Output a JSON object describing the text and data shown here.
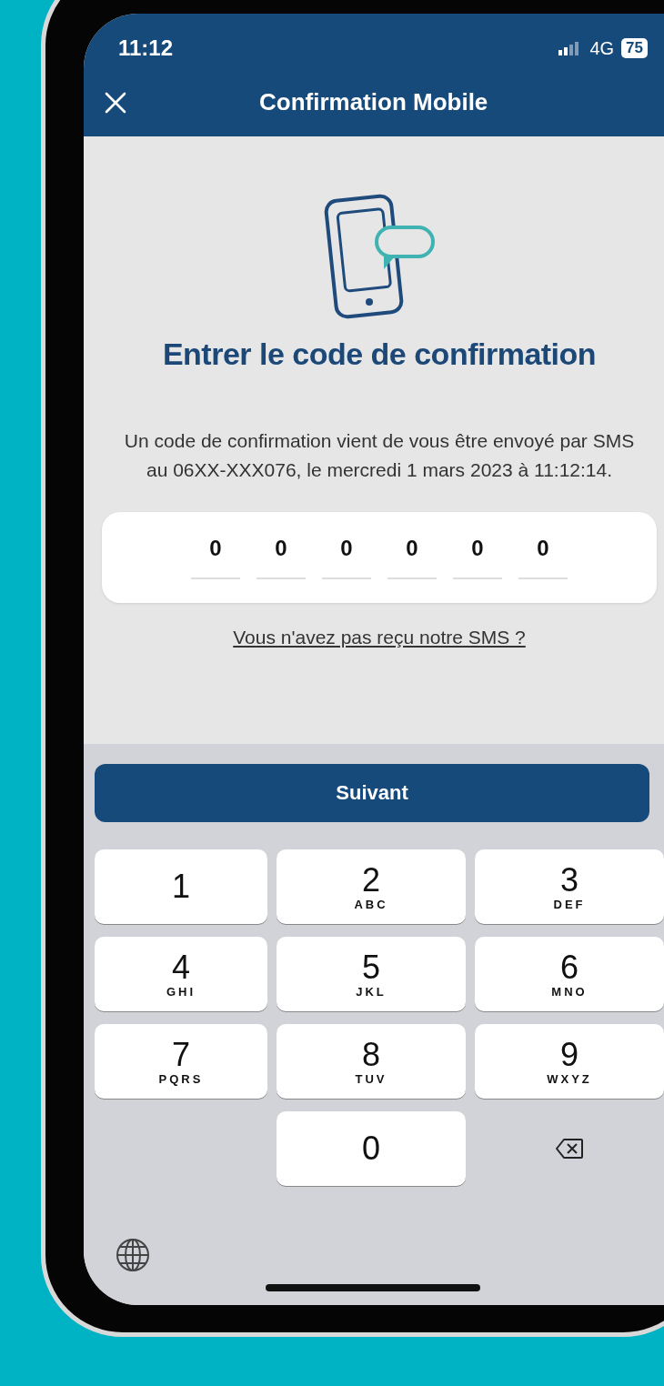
{
  "status_bar": {
    "time": "11:12",
    "network": "4G",
    "battery": "75"
  },
  "header": {
    "title": "Confirmation Mobile"
  },
  "content": {
    "heading": "Entrer le code de confirmation",
    "message": "Un code de confirmation vient de vous être envoyé par SMS au 06XX-XXX076, le mercredi 1 mars 2023 à 11:12:14.",
    "code_fields": [
      {
        "value": "0"
      },
      {
        "value": "0"
      },
      {
        "value": "0"
      },
      {
        "value": "0"
      },
      {
        "value": "0"
      },
      {
        "value": "0"
      }
    ],
    "resend_link": "Vous n'avez pas reçu notre SMS ?"
  },
  "primary_button": "Suivant",
  "keypad": [
    {
      "kind": "digit",
      "digit": "1"
    },
    {
      "kind": "digit",
      "digit": "2",
      "letters": "ABC"
    },
    {
      "kind": "digit",
      "digit": "3",
      "letters": "DEF"
    },
    {
      "kind": "digit",
      "digit": "4",
      "letters": "GHI"
    },
    {
      "kind": "digit",
      "digit": "5",
      "letters": "JKL"
    },
    {
      "kind": "digit",
      "digit": "6",
      "letters": "MNO"
    },
    {
      "kind": "digit",
      "digit": "7",
      "letters": "PQRS"
    },
    {
      "kind": "digit",
      "digit": "8",
      "letters": "TUV"
    },
    {
      "kind": "digit",
      "digit": "9",
      "letters": "WXYZ"
    },
    {
      "kind": "empty"
    },
    {
      "kind": "digit",
      "digit": "0"
    },
    {
      "kind": "delete"
    }
  ]
}
